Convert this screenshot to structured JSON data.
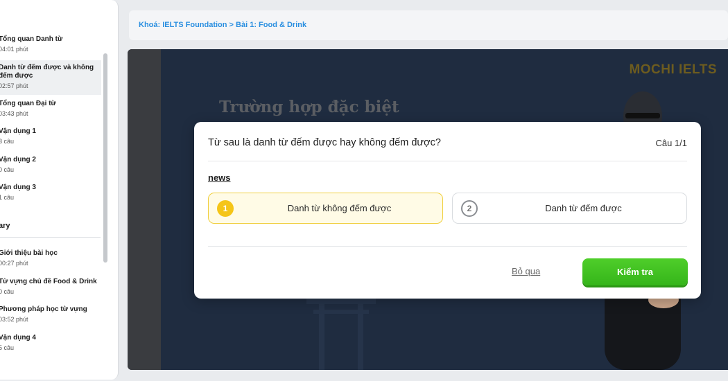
{
  "sidebar": {
    "lessons_top": [
      {
        "title": "Tổng quan Danh từ",
        "meta": "04:01 phút",
        "active": false
      },
      {
        "title": "Danh từ đếm được và không đếm được",
        "meta": "02:57 phút",
        "active": true
      },
      {
        "title": "Tổng quan Đại từ",
        "meta": "03:43 phút",
        "active": false
      },
      {
        "title": "Vận dụng 1",
        "meta": "3 câu",
        "active": false
      },
      {
        "title": "Vận dụng 2",
        "meta": "0 câu",
        "active": false
      },
      {
        "title": "Vận dụng 3",
        "meta": "1 câu",
        "active": false
      }
    ],
    "section_label": "ary",
    "lessons_bottom": [
      {
        "title": "Giới thiệu bài học",
        "meta": "00:27 phút"
      },
      {
        "title": "Từ vựng chủ đề Food & Drink",
        "meta": "0 câu"
      },
      {
        "title": "Phương pháp học từ vựng",
        "meta": "03:52 phút"
      },
      {
        "title": "Vận dụng 4",
        "meta": "5 câu"
      }
    ]
  },
  "header": {
    "breadcrumb": "Khoá: IELTS Foundation > Bài 1: Food & Drink"
  },
  "video": {
    "watermark": "MOCHI IELTS",
    "heading": "Trường hợp đặc biệt"
  },
  "quiz": {
    "question": "Từ sau là danh từ đếm được hay không đếm được?",
    "counter": "Câu 1/1",
    "word": "news",
    "options": [
      {
        "number": "1",
        "label": "Danh từ không đếm được",
        "selected": true
      },
      {
        "number": "2",
        "label": "Danh từ đếm được",
        "selected": false
      }
    ],
    "skip_label": "Bỏ qua",
    "check_label": "Kiểm tra"
  },
  "colors": {
    "accent_blue": "#2a8fe0",
    "check_green": "#3cbf1f",
    "selected_yellow": "#f5c518"
  }
}
